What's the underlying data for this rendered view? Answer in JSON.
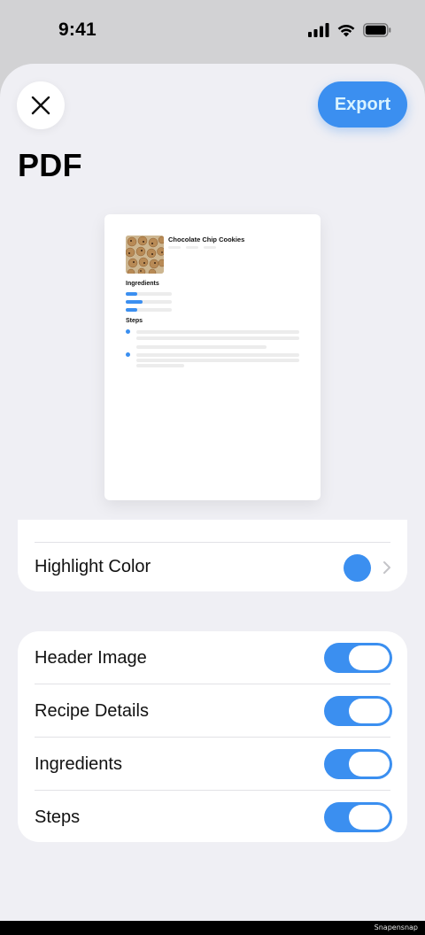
{
  "status_bar": {
    "time": "9:41"
  },
  "header": {
    "close_icon": "close-icon",
    "export_label": "Export",
    "title": "PDF"
  },
  "preview": {
    "recipe_title": "Chocolate Chip Cookies",
    "ingredients_heading": "Ingredients",
    "steps_heading": "Steps",
    "image_icon": "cookies-photo"
  },
  "appearance": {
    "highlight_color_label": "Highlight Color",
    "highlight_color": "#3b8ff0"
  },
  "sections": [
    {
      "label": "Header Image",
      "enabled": true
    },
    {
      "label": "Recipe Details",
      "enabled": true
    },
    {
      "label": "Ingredients",
      "enabled": true
    },
    {
      "label": "Steps",
      "enabled": true
    }
  ],
  "footer": {
    "watermark": "Snapensnap"
  },
  "colors": {
    "accent": "#3b8ff0",
    "export_text": "#d9f3ff",
    "sheet_background": "#efeff4"
  }
}
